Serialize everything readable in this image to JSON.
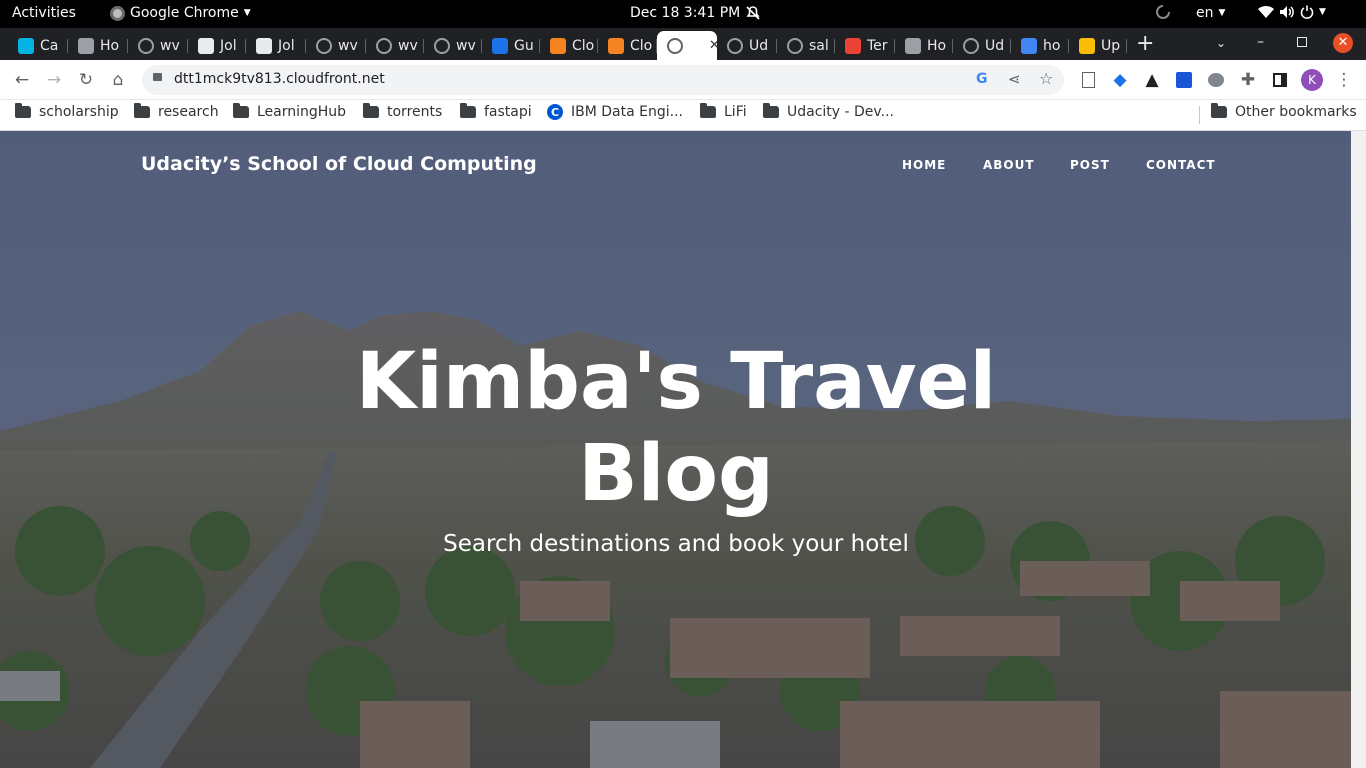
{
  "topbar": {
    "activities": "Activities",
    "app_name": "Google Chrome",
    "clock": "Dec 18  3:41 PM",
    "language": "en"
  },
  "tabs": [
    {
      "label": "Ca",
      "icon": "udacity-icon",
      "color": "#02b3e4"
    },
    {
      "label": "Ho",
      "icon": "alx-icon",
      "color": "#9aa0a6"
    },
    {
      "label": "wv",
      "icon": "globe-icon",
      "color": "#9aa0a6"
    },
    {
      "label": "Jol",
      "icon": "jobberman-icon",
      "color": "#e8eaed"
    },
    {
      "label": "Jol",
      "icon": "jobberman-icon",
      "color": "#e8eaed"
    },
    {
      "label": "wv",
      "icon": "globe-icon",
      "color": "#9aa0a6"
    },
    {
      "label": "wv",
      "icon": "globe-icon",
      "color": "#9aa0a6"
    },
    {
      "label": "wv",
      "icon": "globe-icon",
      "color": "#9aa0a6"
    },
    {
      "label": "Gu",
      "icon": "guide-icon",
      "color": "#1a73e8"
    },
    {
      "label": "Clo",
      "icon": "aws-cube-icon",
      "color": "#f5831f"
    },
    {
      "label": "Clo",
      "icon": "aws-cube-icon",
      "color": "#f5831f"
    },
    {
      "label": "",
      "icon": "globe-icon",
      "color": "#5f6368"
    },
    {
      "label": "Ud",
      "icon": "globe-icon",
      "color": "#9aa0a6"
    },
    {
      "label": "sal",
      "icon": "globe-icon",
      "color": "#9aa0a6"
    },
    {
      "label": "Ter",
      "icon": "gmail-icon",
      "color": "#ea4335"
    },
    {
      "label": "Ho",
      "icon": "alx-icon",
      "color": "#9aa0a6"
    },
    {
      "label": "Ud",
      "icon": "globe-icon",
      "color": "#9aa0a6"
    },
    {
      "label": "ho",
      "icon": "google-icon",
      "color": "#4285f4"
    },
    {
      "label": "Up",
      "icon": "package-icon",
      "color": "#fbbc04"
    }
  ],
  "address": {
    "url": "dtt1mck9tv813.cloudfront.net"
  },
  "bookmarks": [
    {
      "label": "scholarship",
      "icon": "folder-icon"
    },
    {
      "label": "research",
      "icon": "folder-icon"
    },
    {
      "label": "LearningHub",
      "icon": "folder-icon"
    },
    {
      "label": "torrents",
      "icon": "folder-icon"
    },
    {
      "label": "fastapi",
      "icon": "folder-icon"
    },
    {
      "label": "IBM Data Engi...",
      "icon": "coursera-icon"
    },
    {
      "label": "LiFi",
      "icon": "folder-icon"
    },
    {
      "label": "Udacity - Dev...",
      "icon": "folder-icon"
    }
  ],
  "other_bookmarks": "Other bookmarks",
  "profile_initial": "K",
  "site": {
    "brand": "Udacity’s School of Cloud Computing",
    "nav": [
      "HOME",
      "ABOUT",
      "POST",
      "CONTACT"
    ],
    "hero_title": "Kimba's Travel Blog",
    "hero_subtitle": "Search destinations and book your hotel"
  },
  "colors": {
    "topbar": "#000000",
    "tabstrip": "#202124",
    "close_button": "#e94e25",
    "profile": "#8e4fb8"
  }
}
